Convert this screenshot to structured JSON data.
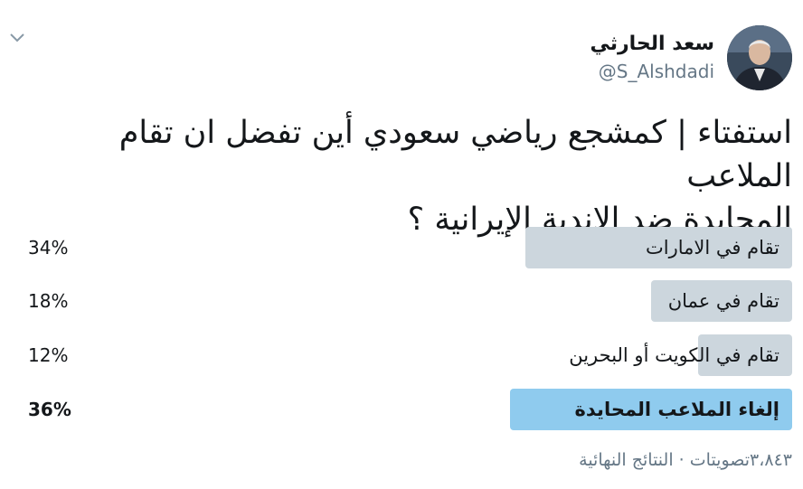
{
  "user": {
    "display_name": "سعد الحارثي",
    "handle": "@S_Alshdadi"
  },
  "icons": {
    "menu": "chevron-down-icon",
    "avatar": "profile-photo"
  },
  "tweet": {
    "line1": "استفتاء | كمشجع رياضي سعودي أين تفضل ان تقام الملاعب",
    "line2": "المحايدة ضد الاندية الإيرانية ؟"
  },
  "poll": {
    "options": [
      {
        "label": "تقام في الامارات",
        "percent_text": "34%",
        "percent": 34,
        "winner": false
      },
      {
        "label": "تقام في عمان",
        "percent_text": "18%",
        "percent": 18,
        "winner": false
      },
      {
        "label": "تقام في الكويت أو البحرين",
        "percent_text": "12%",
        "percent": 12,
        "winner": false
      },
      {
        "label": "إلغاء الملاعب المحايدة",
        "percent_text": "36%",
        "percent": 36,
        "winner": true
      }
    ],
    "votes": "٣،٨٤٣تصويتات",
    "separator": "·",
    "status": "النتائج النهائية"
  },
  "colors": {
    "bar": "#ccd6dd",
    "winner_bar": "#8fcbee",
    "secondary_text": "#657786"
  }
}
